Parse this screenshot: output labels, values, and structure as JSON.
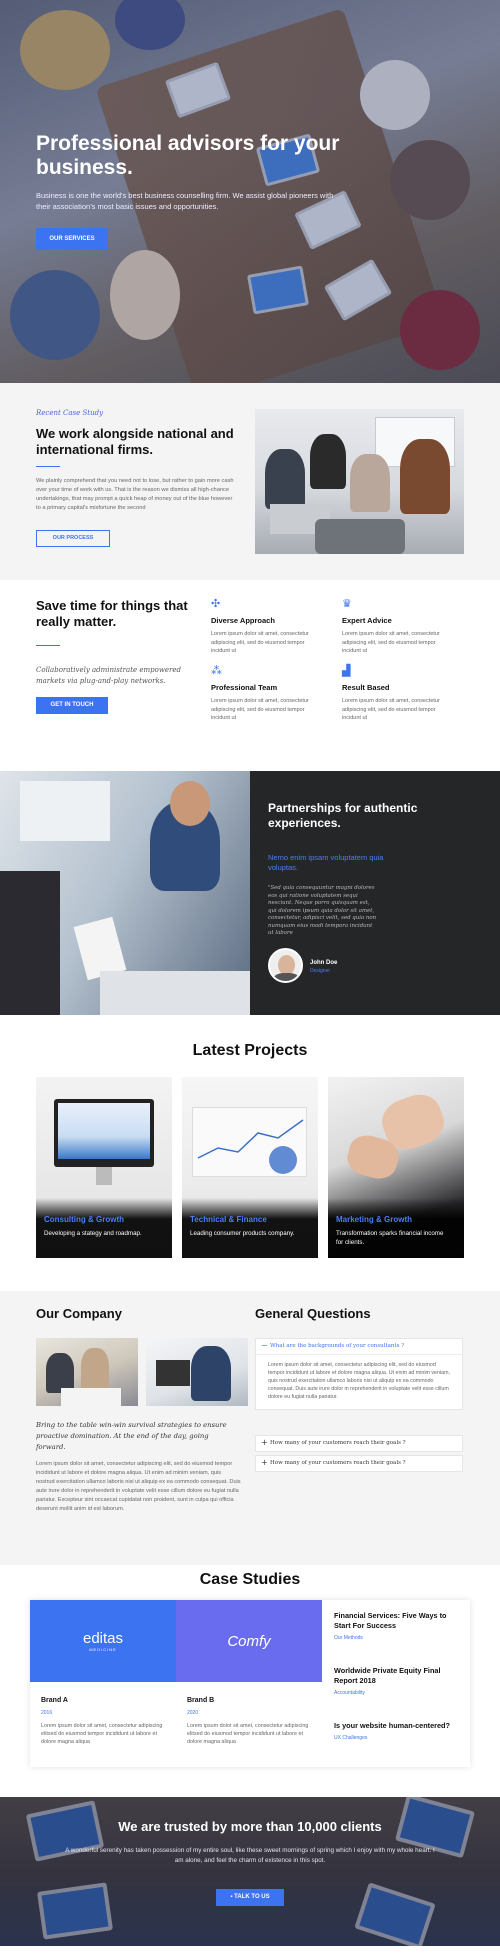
{
  "hero": {
    "title": "Professional advisors for your business.",
    "subtitle": "Business is one the world's best business counselling firm. We assist global pioneers with their association's most basic issues and opportunities.",
    "button": "OUR SERVICES"
  },
  "case_study": {
    "eyebrow": "Recent Case Study",
    "title": "We work alongside national and international firms.",
    "body": "We plainly comprehend that you need not to lose, but rather to gain more cash over your time of work with us. That is the reason we dismiss all high-chance undertakings, that may prompt a quick heap of money out of the blue however to a primary capital's misfortune the second",
    "button": "OUR PROCESS"
  },
  "save_time": {
    "title": "Save time for things that really matter.",
    "quote": "Collaboratively administrate empowered markets via plug-and-play networks.",
    "button": "GET IN TOUCH",
    "features": [
      {
        "icon": "network-icon",
        "title": "Diverse Approach",
        "text": "Lorem ipsum dolor sit amet, consectetur adipiscing elit, sed do eiusmod tempor incidunt ut"
      },
      {
        "icon": "crown-icon",
        "title": "Expert Advice",
        "text": "Lorem ipsum dolor sit amet, consectetur adipiscing elit, sed do eiusmod tempor incidunt ut"
      },
      {
        "icon": "nodes-icon",
        "title": "Professional Team",
        "text": "Lorem ipsum dolor sit amet, consectetur adipiscing elit, sed do eiusmod tempor incidunt ut"
      },
      {
        "icon": "chart-icon",
        "title": "Result Based",
        "text": "Lorem ipsum dolor sit amet, consectetur adipiscing elit, sed do eiusmod tempor incidunt ut"
      }
    ]
  },
  "partnership": {
    "title": "Partnerships for authentic experiences.",
    "subtitle": "Nemo enim ipsam voluptatem quia voluptas.",
    "quote": "\"Sed quia consequuntur magni dolores eos qui ratione voluptatem sequi nesciunt. Neque porro quisquam est, qui dolorem ipsum quia dolor sit amet, consectetur, adipisci velit, sed quia non numquam eius modi tempora incidunt ut labore",
    "author_name": "John Doe",
    "author_role": "Designer"
  },
  "projects": {
    "title": "Latest Projects",
    "items": [
      {
        "category": "Consulting & Growth",
        "desc": "Developing a stategy and roadmap."
      },
      {
        "category": "Technical & Finance",
        "desc": "Leading consumer products company."
      },
      {
        "category": "Marketing & Growth",
        "desc": "Transformation sparks financial income for clients."
      }
    ]
  },
  "company": {
    "title": "Our Company",
    "quote": "Bring to the table win-win survival strategies to ensure proactive domination. At the end of the day, going forward.",
    "body": "Lorem ipsum dolor sit amet, consectetur adipiscing elit, sed do eiusmod tempor incididunt ut labore et dolore magna aliqua. Ut enim ad minim veniam, quis nostrud exercitation ullamco laboris nisi ut aliquip ex ea commodo consequat. Duis aute irure dolor in reprehenderit in voluptate velit esse cillum dolore eu fugiat nulla pariatur. Excepteur sint occaecat cupidatat non proident, sunt in culpa qui officia deserunt mollit anim id est laborum."
  },
  "questions": {
    "title": "General Questions",
    "items": [
      {
        "q": "What are the backgrounds of your consultants ?",
        "a": "Lorem ipsum dolor sit amet, consectetur adipiscing elit, sed do eiusmod tempor incididunt ut labore et dolore magna aliqua. Ut enim ad minim veniam, quis nostrud exercitation ullamco laboris nisi ut aliquip ex ea commodo consequat. Duis aute irure dolor in reprehenderit in voluptate velit esse cillum dolore eu fugiat nulla pariatur.",
        "sign": "−"
      },
      {
        "q": "How many of your customers reach their goals ?",
        "sign": "+"
      },
      {
        "q": "How many of your customers reach their goals ?",
        "sign": "+"
      }
    ]
  },
  "case_studies": {
    "title": "Case Studies",
    "brands": [
      {
        "logo": "editas",
        "logo_sub": "MEDICINE",
        "name": "Brand A",
        "year": "2016",
        "text": "Lorem ipsum dolor sit amet, consectetur adipiscing elitsed do eiusmod tempor incididunt ut labore et dolore magna aliqua",
        "color": "#3b73f0"
      },
      {
        "logo": "Comfy",
        "logo_sub": "",
        "name": "Brand B",
        "year": "2020",
        "text": "Lorem ipsum dolor sit amet, consectetur adipiscing elitsed do eiusmod tempor incididunt ut labore et dolore magna aliqua",
        "color": "#6a6cf0"
      }
    ],
    "side": [
      {
        "title": "Financial Services: Five Ways to Start For Success",
        "tag": "Our Methods"
      },
      {
        "title": "Worldwide Private Equity Final Report 2018",
        "tag": "Accountability"
      },
      {
        "title": "Is your website human-centered?",
        "tag": "UX Challenges"
      }
    ]
  },
  "trust": {
    "title": "We are trusted by more than 10,000 clients",
    "text": "A wonderful serenity has taken possession of my entire soul, like these sweet mornings of spring which I enjoy with my whole heart. I am alone, and feel the charm of existence in this spot.",
    "button": "TALK TO US"
  }
}
